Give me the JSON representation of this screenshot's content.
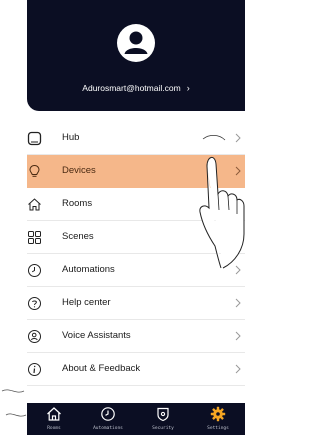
{
  "account": {
    "email": "Adurosmart@hotmail.com"
  },
  "menu": [
    {
      "label": "Hub",
      "icon": "hub-icon"
    },
    {
      "label": "Devices",
      "icon": "bulb-icon",
      "active": true
    },
    {
      "label": "Rooms",
      "icon": "home-icon"
    },
    {
      "label": "Scenes",
      "icon": "scenes-icon"
    },
    {
      "label": "Automations",
      "icon": "clock-icon"
    },
    {
      "label": "Help center",
      "icon": "help-icon"
    },
    {
      "label": "Voice Assistants",
      "icon": "voice-icon"
    },
    {
      "label": "About & Feedback",
      "icon": "info-icon"
    }
  ],
  "tabs": [
    {
      "label": "Rooms",
      "icon": "home-icon"
    },
    {
      "label": "Automations",
      "icon": "clock-icon"
    },
    {
      "label": "Security",
      "icon": "shield-icon"
    },
    {
      "label": "Settings",
      "icon": "gear-icon",
      "active": true
    }
  ],
  "colors": {
    "header_bg": "#0b0e23",
    "active_row": "#f5b78a",
    "active_tab": "#f5a623"
  }
}
